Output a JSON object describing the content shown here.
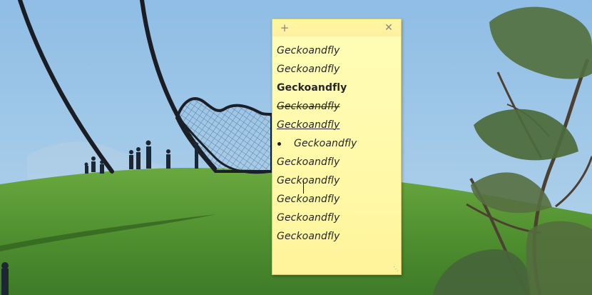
{
  "note": {
    "add_icon": "+",
    "close_icon": "✕",
    "resize_grip": "⋱",
    "lines": [
      "Geckoandfly",
      "Geckoandfly",
      "Geckoandfly",
      "Geckoandfly",
      "Geckoandfly",
      "Geckoandfly",
      "Geckoandfly",
      "Geckoandfly",
      "Geckoandfly",
      "Geckoandfly",
      "Geckoandfly"
    ]
  },
  "theme": {
    "note_background": "#fff8a6",
    "note_header": "#fff0a0",
    "sky": "#9cc3e6",
    "grass": "#4f8f2f"
  }
}
